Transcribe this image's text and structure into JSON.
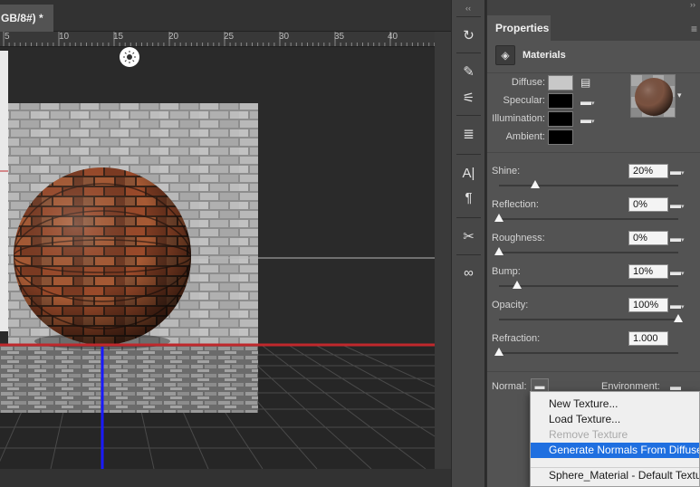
{
  "document": {
    "tab_title": "GB/8#) *",
    "ruler_ticks": [
      "5",
      "10",
      "15",
      "20",
      "25",
      "30",
      "35",
      "40"
    ]
  },
  "toolbar": {
    "collapse_glyph": "‹‹",
    "tools": [
      {
        "name": "history-icon",
        "glyph": "↻"
      },
      {
        "name": "brushes-icon",
        "glyph": "✎"
      },
      {
        "name": "adjustments-icon",
        "glyph": "⚟"
      },
      {
        "name": "clone-source-icon",
        "glyph": "≣"
      },
      {
        "name": "character-icon",
        "glyph": "A|"
      },
      {
        "name": "paragraph-icon",
        "glyph": "¶"
      },
      {
        "name": "tools-icon",
        "glyph": "✂"
      },
      {
        "name": "creative-cloud-icon",
        "glyph": "∞"
      }
    ]
  },
  "properties": {
    "collapse_glyph": "››",
    "tab_label": "Properties",
    "menu_glyph": "≡",
    "section_title": "Materials",
    "colors": [
      {
        "label": "Diffuse:",
        "swatch": "#c8c8c8",
        "has_icon": true
      },
      {
        "label": "Specular:",
        "swatch": "#000000",
        "has_icon": false
      },
      {
        "label": "Illumination:",
        "swatch": "#000000",
        "has_icon": false
      },
      {
        "label": "Ambient:",
        "swatch": "#000000",
        "has_icon": false
      }
    ],
    "sliders": [
      {
        "label": "Shine:",
        "value": "20%",
        "fraction": 0.2
      },
      {
        "label": "Reflection:",
        "value": "0%",
        "fraction": 0.0
      },
      {
        "label": "Roughness:",
        "value": "0%",
        "fraction": 0.0
      },
      {
        "label": "Bump:",
        "value": "10%",
        "fraction": 0.1
      },
      {
        "label": "Opacity:",
        "value": "100%",
        "fraction": 1.0
      },
      {
        "label": "Refraction:",
        "value": "1.000",
        "fraction": 0.0
      }
    ],
    "normal_label": "Normal:",
    "environment_label": "Environment:"
  },
  "context_menu": {
    "items": [
      {
        "label": "New Texture...",
        "state": "normal"
      },
      {
        "label": "Load Texture...",
        "state": "normal"
      },
      {
        "label": "Remove Texture",
        "state": "disabled"
      },
      {
        "label": "Generate Normals From Diffuse...",
        "state": "highlighted"
      }
    ],
    "footer_item": "Sphere_Material - Default Texture"
  },
  "colors": {
    "accent": "#1f6fe0",
    "panel": "#535353",
    "ground_plane_axis": "#c0282c",
    "vertical_axis": "#1a1aff"
  }
}
